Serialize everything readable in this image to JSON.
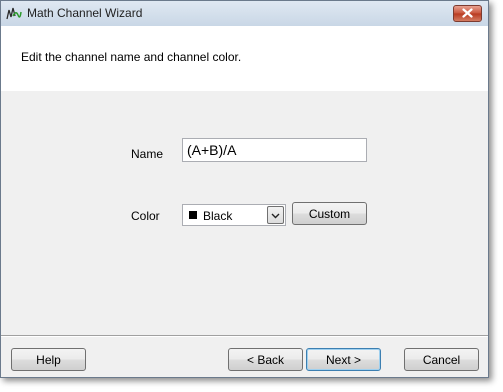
{
  "window": {
    "title": "Math Channel Wizard"
  },
  "header": {
    "instruction": "Edit the channel name and channel color."
  },
  "form": {
    "name_label": "Name",
    "name_value": "(A+B)/A",
    "color_label": "Color",
    "color_value": "Black",
    "color_swatch": "#000000",
    "custom_label": "Custom"
  },
  "footer": {
    "help_label": "Help",
    "back_label": "< Back",
    "next_label": "Next >",
    "cancel_label": "Cancel"
  },
  "icons": {
    "app": "math-waveform-icon",
    "close": "close-icon",
    "dropdown": "chevron-down-icon"
  }
}
